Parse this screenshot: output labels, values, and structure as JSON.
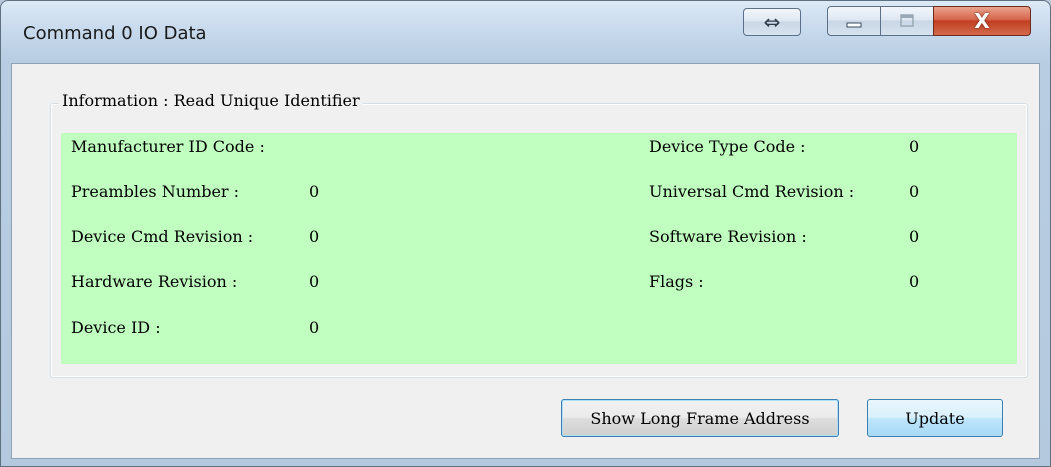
{
  "window": {
    "title": "Command 0 IO Data",
    "controls": {
      "resize_glyph": "⇔",
      "minimize_glyph": "—",
      "maximize_glyph": "□",
      "close_glyph": "X"
    }
  },
  "group": {
    "legend": "Information : Read Unique Identifier"
  },
  "fields": {
    "manufacturer_id_code": {
      "label": "Manufacturer ID Code :",
      "value": ""
    },
    "device_type_code": {
      "label": "Device Type Code :",
      "value": "0"
    },
    "preambles_number": {
      "label": "Preambles Number :",
      "value": "0"
    },
    "universal_cmd_revision": {
      "label": "Universal Cmd Revision :",
      "value": "0"
    },
    "device_cmd_revision": {
      "label": "Device Cmd Revision :",
      "value": "0"
    },
    "software_revision": {
      "label": "Software Revision :",
      "value": "0"
    },
    "hardware_revision": {
      "label": "Hardware Revision :",
      "value": "0"
    },
    "flags": {
      "label": "Flags :",
      "value": "0"
    },
    "device_id": {
      "label": "Device ID :",
      "value": "0"
    }
  },
  "buttons": {
    "show_long_frame": "Show Long Frame Address",
    "update": "Update"
  },
  "colors": {
    "info_panel_bg": "#c0ffc0",
    "client_bg": "#f0f0f0",
    "close_button": "#c23e22"
  }
}
